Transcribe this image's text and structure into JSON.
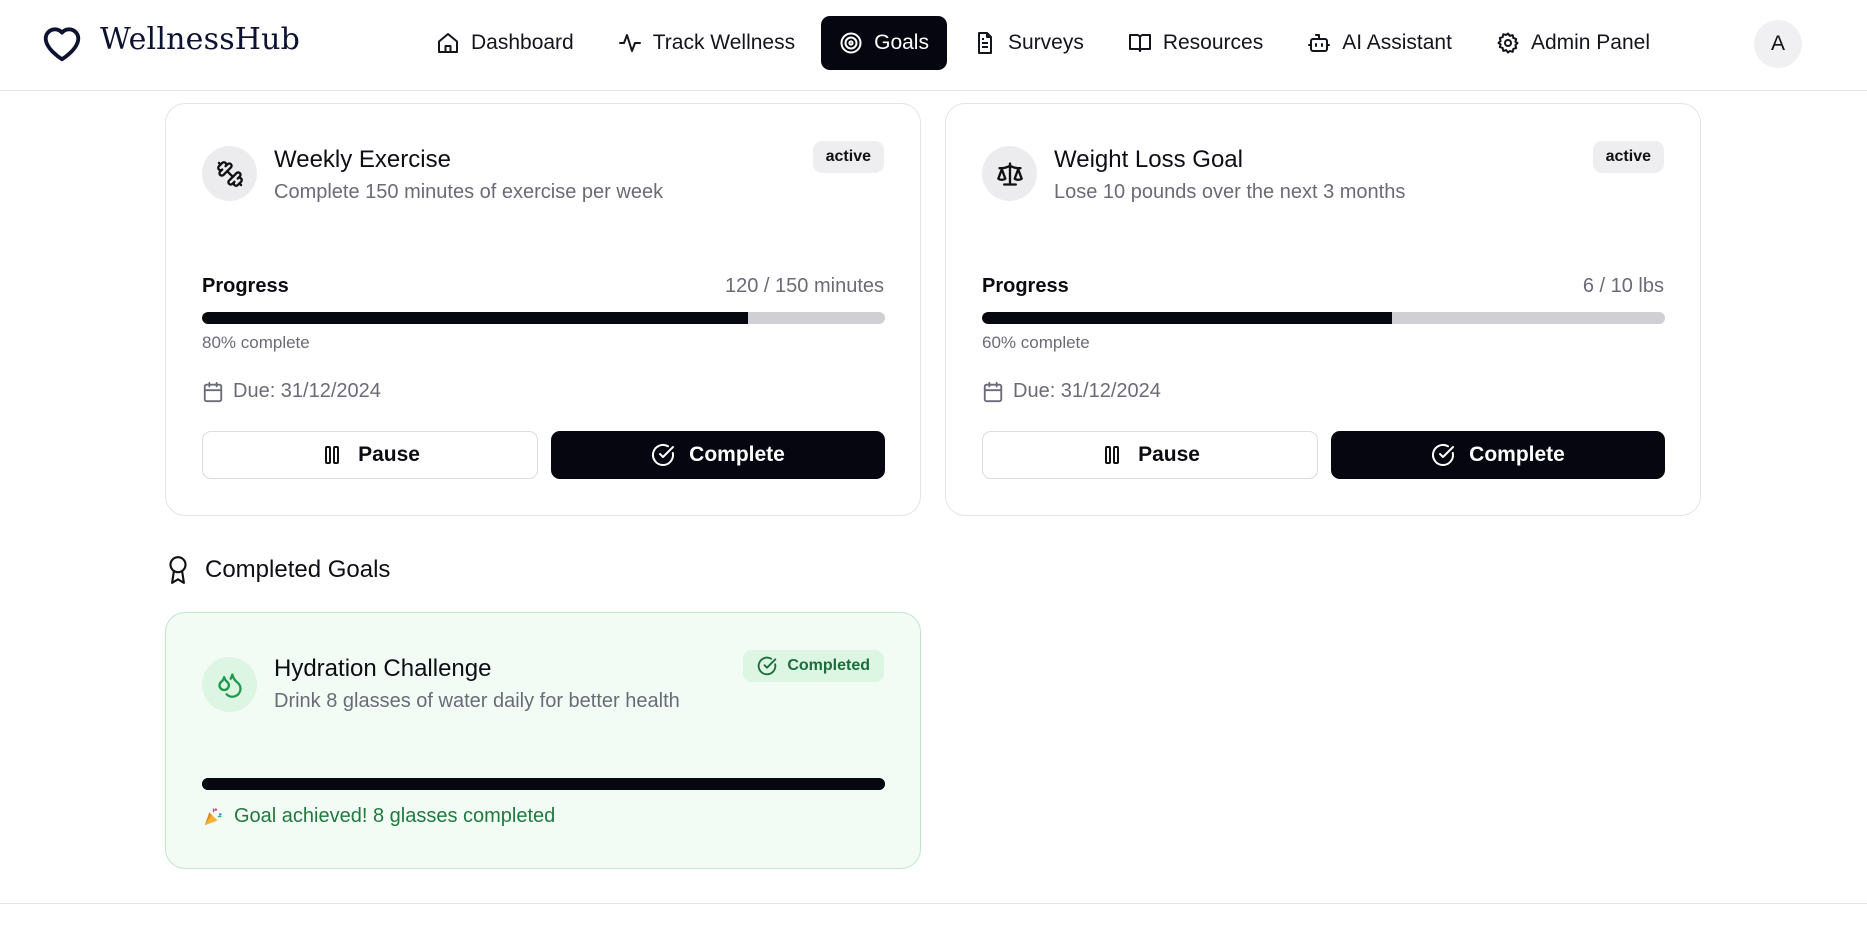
{
  "brand": {
    "name": "WellnessHub"
  },
  "nav": {
    "items": [
      {
        "label": "Dashboard",
        "icon": "home-icon",
        "active": false
      },
      {
        "label": "Track Wellness",
        "icon": "activity-icon",
        "active": false
      },
      {
        "label": "Goals",
        "icon": "target-icon",
        "active": true
      },
      {
        "label": "Surveys",
        "icon": "file-text-icon",
        "active": false
      },
      {
        "label": "Resources",
        "icon": "book-icon",
        "active": false
      },
      {
        "label": "AI Assistant",
        "icon": "bot-icon",
        "active": false
      },
      {
        "label": "Admin Panel",
        "icon": "gear-icon",
        "active": false
      }
    ],
    "avatar_initial": "A"
  },
  "active_goals": [
    {
      "title": "Weekly Exercise",
      "description": "Complete 150 minutes of exercise per week",
      "status": "active",
      "icon": "dumbbell-icon",
      "progress_label": "Progress",
      "progress_value": "120 / 150 minutes",
      "progress_fraction": 0.8,
      "percent_text": "80% complete",
      "due": "Due: 31/12/2024",
      "pause_label": "Pause",
      "complete_label": "Complete"
    },
    {
      "title": "Weight Loss Goal",
      "description": "Lose 10 pounds over the next 3 months",
      "status": "active",
      "icon": "scale-icon",
      "progress_label": "Progress",
      "progress_value": "6 / 10 lbs",
      "progress_fraction": 0.6,
      "percent_text": "60% complete",
      "due": "Due: 31/12/2024",
      "pause_label": "Pause",
      "complete_label": "Complete"
    }
  ],
  "completed_section": {
    "heading": "Completed Goals",
    "goals": [
      {
        "title": "Hydration Challenge",
        "description": "Drink 8 glasses of water daily for better health",
        "status": "Completed",
        "icon": "droplets-icon",
        "progress_fraction": 1.0,
        "achieved_text": "Goal achieved! 8 glasses completed"
      }
    ]
  },
  "colors": {
    "primary": "#05060f",
    "muted_text": "#6b6b78",
    "success_text": "#1f7a3f",
    "success_bg": "#f3fbf5",
    "success_badge_bg": "#dcf6e3"
  }
}
